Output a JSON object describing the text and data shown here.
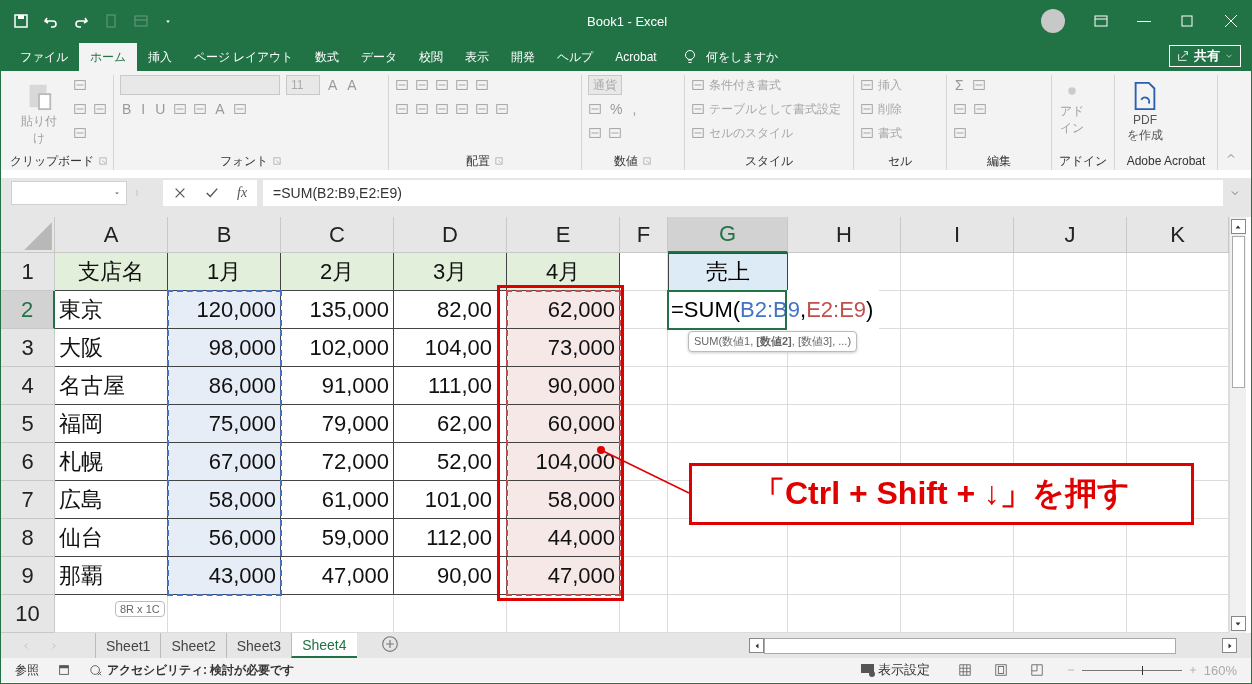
{
  "window": {
    "title": "Book1  -  Excel"
  },
  "ribbon_tabs": [
    {
      "label": "ファイル",
      "selected": false
    },
    {
      "label": "ホーム",
      "selected": true
    },
    {
      "label": "挿入",
      "selected": false
    },
    {
      "label": "ページ レイアウト",
      "selected": false
    },
    {
      "label": "数式",
      "selected": false
    },
    {
      "label": "データ",
      "selected": false
    },
    {
      "label": "校閲",
      "selected": false
    },
    {
      "label": "表示",
      "selected": false
    },
    {
      "label": "開発",
      "selected": false
    },
    {
      "label": "ヘルプ",
      "selected": false
    },
    {
      "label": "Acrobat",
      "selected": false
    }
  ],
  "tell_me": {
    "placeholder": "何をしますか"
  },
  "share_button": {
    "label": "共有"
  },
  "ribbon_groups": [
    {
      "label": "クリップボード",
      "launcher": true,
      "large": [
        {
          "text": "貼り付け"
        }
      ],
      "rows": [
        [
          {
            "kind": "icon"
          }
        ],
        [
          {
            "kind": "icon"
          },
          {
            "kind": "icon"
          }
        ],
        [
          {
            "kind": "icon"
          }
        ]
      ]
    },
    {
      "label": "フォント",
      "launcher": true,
      "rows": [
        [
          {
            "kind": "field"
          },
          {
            "kind": "field",
            "text": "11"
          },
          {
            "kind": "text",
            "text": "A"
          },
          {
            "kind": "text",
            "text": "A"
          }
        ],
        [
          {
            "kind": "text",
            "text": "B"
          },
          {
            "kind": "text",
            "text": "I"
          },
          {
            "kind": "text",
            "text": "U"
          },
          {
            "kind": "icon"
          },
          {
            "kind": "icon"
          },
          {
            "kind": "text",
            "text": "A"
          },
          {
            "kind": "icon"
          }
        ]
      ]
    },
    {
      "label": "配置",
      "launcher": true,
      "rows": [
        [
          {
            "kind": "icon"
          },
          {
            "kind": "icon"
          },
          {
            "kind": "icon"
          },
          {
            "kind": "icon"
          },
          {
            "kind": "icon"
          }
        ],
        [
          {
            "kind": "icon"
          },
          {
            "kind": "icon"
          },
          {
            "kind": "icon"
          },
          {
            "kind": "icon"
          },
          {
            "kind": "icon"
          },
          {
            "kind": "icon"
          }
        ]
      ]
    },
    {
      "label": "数値",
      "launcher": true,
      "rows": [
        [
          {
            "kind": "field",
            "text": "通貨"
          }
        ],
        [
          {
            "kind": "icon"
          },
          {
            "kind": "text",
            "text": "%"
          },
          {
            "kind": "text",
            "text": ","
          }
        ],
        [
          {
            "kind": "icon"
          },
          {
            "kind": "icon"
          }
        ]
      ]
    },
    {
      "label": "スタイル",
      "launcher": false,
      "rows": [
        [
          {
            "kind": "icon_text",
            "text": "条件付き書式"
          }
        ],
        [
          {
            "kind": "icon_text",
            "text": "テーブルとして書式設定"
          }
        ],
        [
          {
            "kind": "icon_text",
            "text": "セルのスタイル"
          }
        ]
      ]
    },
    {
      "label": "セル",
      "launcher": false,
      "rows": [
        [
          {
            "kind": "icon_text",
            "text": "挿入"
          }
        ],
        [
          {
            "kind": "icon_text",
            "text": "削除"
          }
        ],
        [
          {
            "kind": "icon_text",
            "text": "書式"
          }
        ]
      ]
    },
    {
      "label": "編集",
      "launcher": false,
      "rows": [
        [
          {
            "kind": "text",
            "text": "Σ"
          },
          {
            "kind": "icon"
          }
        ],
        [
          {
            "kind": "icon"
          },
          {
            "kind": "icon"
          }
        ],
        [
          {
            "kind": "icon"
          }
        ]
      ]
    },
    {
      "label": "アドイン",
      "launcher": false,
      "large": [
        {
          "text": "アドイン"
        }
      ]
    },
    {
      "label": "Adobe Acrobat",
      "launcher": false,
      "large": [
        {
          "text": "PDF\nを作成"
        }
      ]
    }
  ],
  "formula_bar": {
    "function_label": "fx",
    "formula": "=SUM(B2:B9,E2:E9)"
  },
  "table": {
    "columns": [
      {
        "label": "A",
        "selected": false
      },
      {
        "label": "B",
        "selected": false,
        "color": "#4472c4"
      },
      {
        "label": "C",
        "selected": false
      },
      {
        "label": "D",
        "selected": false
      },
      {
        "label": "E",
        "selected": false,
        "color": "#c0504d"
      },
      {
        "label": "F",
        "selected": false
      },
      {
        "label": "G",
        "selected": true
      },
      {
        "label": "H",
        "selected": false
      },
      {
        "label": "I",
        "selected": false
      },
      {
        "label": "J",
        "selected": false
      },
      {
        "label": "K",
        "selected": false
      }
    ],
    "rows": [
      {
        "label": "1",
        "selected": false,
        "cells": [
          "支店名",
          "1月",
          "2月",
          "3月",
          "4月"
        ]
      },
      {
        "label": "2",
        "selected": true,
        "cells": [
          "東京",
          "120,000",
          "135,000",
          "82,00",
          "62,000"
        ]
      },
      {
        "label": "3",
        "selected": false,
        "cells": [
          "大阪",
          "98,000",
          "102,000",
          "104,00",
          "73,000"
        ]
      },
      {
        "label": "4",
        "selected": false,
        "cells": [
          "名古屋",
          "86,000",
          "91,000",
          "111,00",
          "90,000"
        ]
      },
      {
        "label": "5",
        "selected": false,
        "cells": [
          "福岡",
          "75,000",
          "79,000",
          "62,00",
          "60,000"
        ]
      },
      {
        "label": "6",
        "selected": false,
        "cells": [
          "札幌",
          "67,000",
          "72,000",
          "52,00",
          "104,000"
        ]
      },
      {
        "label": "7",
        "selected": false,
        "cells": [
          "広島",
          "58,000",
          "61,000",
          "101,00",
          "58,000"
        ]
      },
      {
        "label": "8",
        "selected": false,
        "cells": [
          "仙台",
          "56,000",
          "59,000",
          "112,00",
          "44,000"
        ]
      },
      {
        "label": "9",
        "selected": false,
        "cells": [
          "那覇",
          "43,000",
          "47,000",
          "90,00",
          "47,000"
        ]
      },
      {
        "label": "10",
        "selected": false,
        "cells": []
      }
    ],
    "sales_header": "売上",
    "editing_cell": [
      {
        "text": "=SUM("
      },
      {
        "text": "B2:B9",
        "color": "#4472c4"
      },
      {
        "text": ","
      },
      {
        "text": "E2:E9",
        "color": "#c0504d"
      },
      {
        "text": ")"
      }
    ],
    "function_tooltip": "SUM(数値1, **[数値2]**, [数値3], ...)",
    "selection_tooltip": "8R x 1C"
  },
  "callout": {
    "text": "「Ctrl + Shift + ↓」を押す"
  },
  "sheet_tabs": [
    {
      "label": "Sheet1",
      "selected": false
    },
    {
      "label": "Sheet2",
      "selected": false
    },
    {
      "label": "Sheet3",
      "selected": false
    },
    {
      "label": "Sheet4",
      "selected": true
    }
  ],
  "status_bar": {
    "mode": "参照",
    "accessibility": "アクセシビリティ: 検討が必要です",
    "display_settings": "表示設定",
    "zoom": {
      "level": 0.6,
      "reading": "160%"
    }
  }
}
